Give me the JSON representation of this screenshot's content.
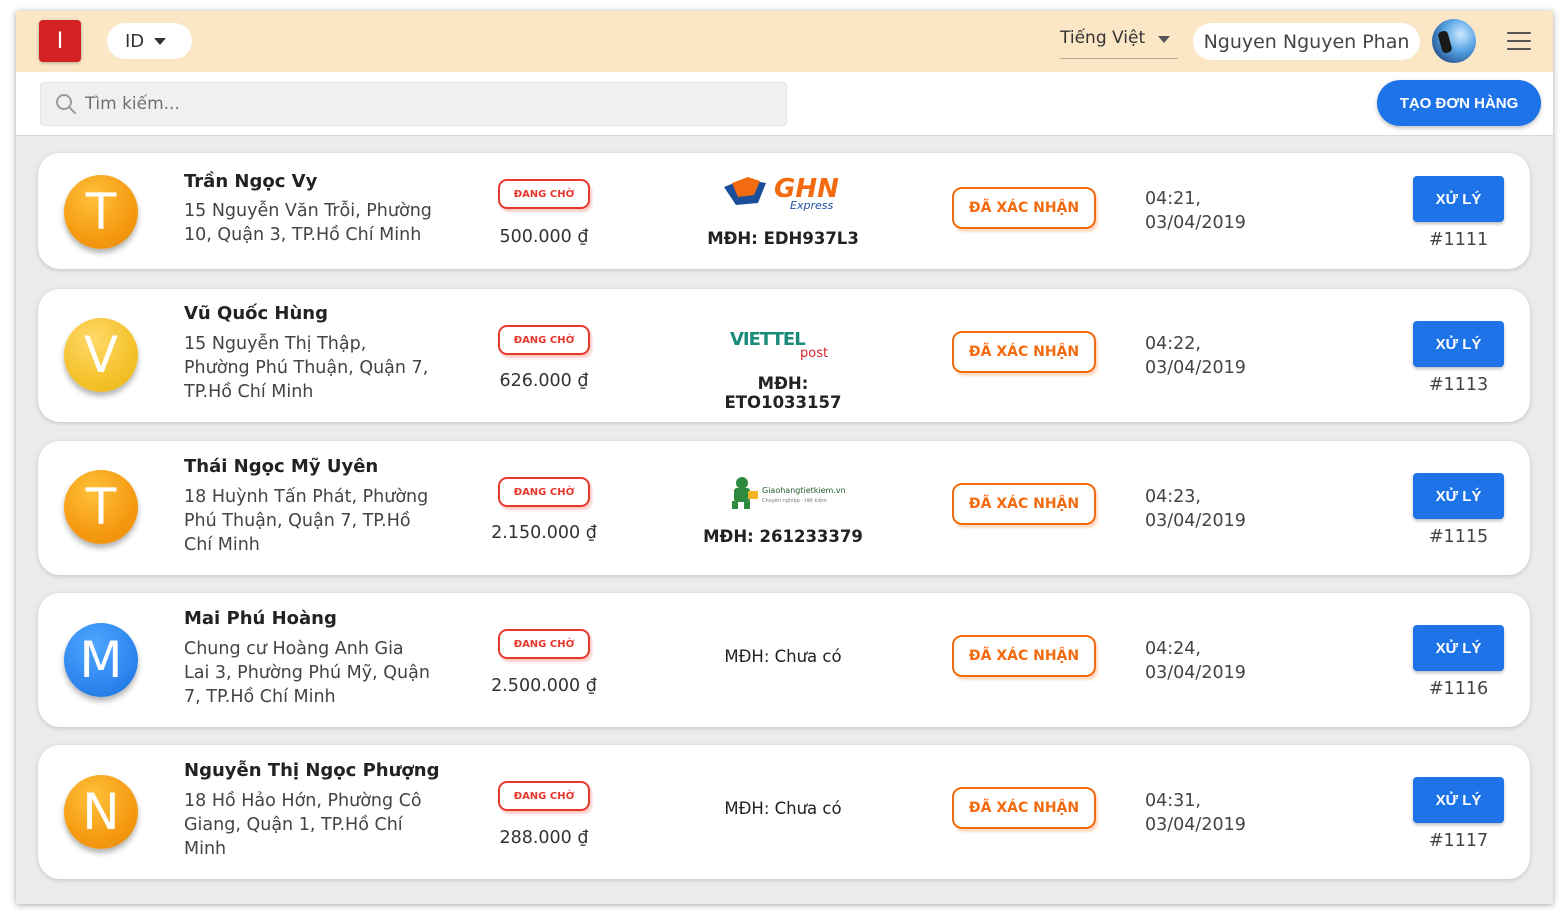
{
  "header": {
    "logo_letter": "I",
    "id_selector": "ID",
    "language": "Tiếng Việt",
    "user_name": "Nguyen Nguyen Phan"
  },
  "search": {
    "placeholder": "Tìm kiếm...",
    "create_button": "TẠO ĐƠN HÀNG"
  },
  "orders": [
    {
      "initial": "T",
      "avatar_color": "#f59a12",
      "name": "Trần Ngọc Vy",
      "address": "15 Nguyễn Văn Trỗi, Phường 10, Quận 3, TP.Hồ Chí Minh",
      "status": "ĐANG CHỜ",
      "amount": "500.000 ₫",
      "carrier": "GHN Express",
      "carrier_logo": "ghn-logo",
      "tracking": "MĐH: EDH937L3",
      "confirmation": "ĐÃ XÁC NHẬN",
      "time": "04:21,",
      "date": "03/04/2019",
      "action": "XỬ LÝ",
      "order_id": "#1111"
    },
    {
      "initial": "V",
      "avatar_color": "#f4c22b",
      "name": "Vũ Quốc Hùng",
      "address": "15 Nguyễn Thị Thập, Phường Phú Thuận, Quận 7, TP.Hồ Chí Minh",
      "status": "ĐANG CHỜ",
      "amount": "626.000 ₫",
      "carrier": "Viettel post",
      "carrier_logo": "viettel-post-logo",
      "tracking": "MĐH: ETO1033157",
      "confirmation": "ĐÃ XÁC NHẬN",
      "time": "04:22,",
      "date": "03/04/2019",
      "action": "XỬ LÝ",
      "order_id": "#1113"
    },
    {
      "initial": "T",
      "avatar_color": "#f59a12",
      "name": "Thái Ngọc Mỹ Uyên",
      "address": "18 Huỳnh Tấn Phát, Phường Phú Thuận, Quận 7, TP.Hồ Chí Minh",
      "status": "ĐANG CHỜ",
      "amount": "2.150.000 ₫",
      "carrier": "Giaohangtietkiem.vn",
      "carrier_logo": "ghtk-logo",
      "tracking": "MĐH: 261233379",
      "confirmation": "ĐÃ XÁC NHẬN",
      "time": "04:23,",
      "date": "03/04/2019",
      "action": "XỬ LÝ",
      "order_id": "#1115"
    },
    {
      "initial": "M",
      "avatar_color": "#2e86ef",
      "name": "Mai Phú Hoàng",
      "address": "Chung cư Hoàng Anh Gia Lai 3, Phường Phú Mỹ, Quận 7, TP.Hồ Chí Minh",
      "status": "ĐANG CHỜ",
      "amount": "2.500.000 ₫",
      "carrier": "",
      "carrier_logo": "",
      "tracking": "MĐH: Chưa có",
      "confirmation": "ĐÃ XÁC NHẬN",
      "time": "04:24,",
      "date": "03/04/2019",
      "action": "XỬ LÝ",
      "order_id": "#1116"
    },
    {
      "initial": "N",
      "avatar_color": "#f59a12",
      "name": "Nguyễn Thị Ngọc Phượng",
      "address": "18 Hồ Hảo Hớn, Phường Cô Giang, Quận 1, TP.Hồ Chí Minh",
      "status": "ĐANG CHỜ",
      "amount": "288.000 ₫",
      "carrier": "",
      "carrier_logo": "",
      "tracking": "MĐH: Chưa có",
      "confirmation": "ĐÃ XÁC NHẬN",
      "time": "04:31,",
      "date": "03/04/2019",
      "action": "XỬ LÝ",
      "order_id": "#1117"
    }
  ]
}
